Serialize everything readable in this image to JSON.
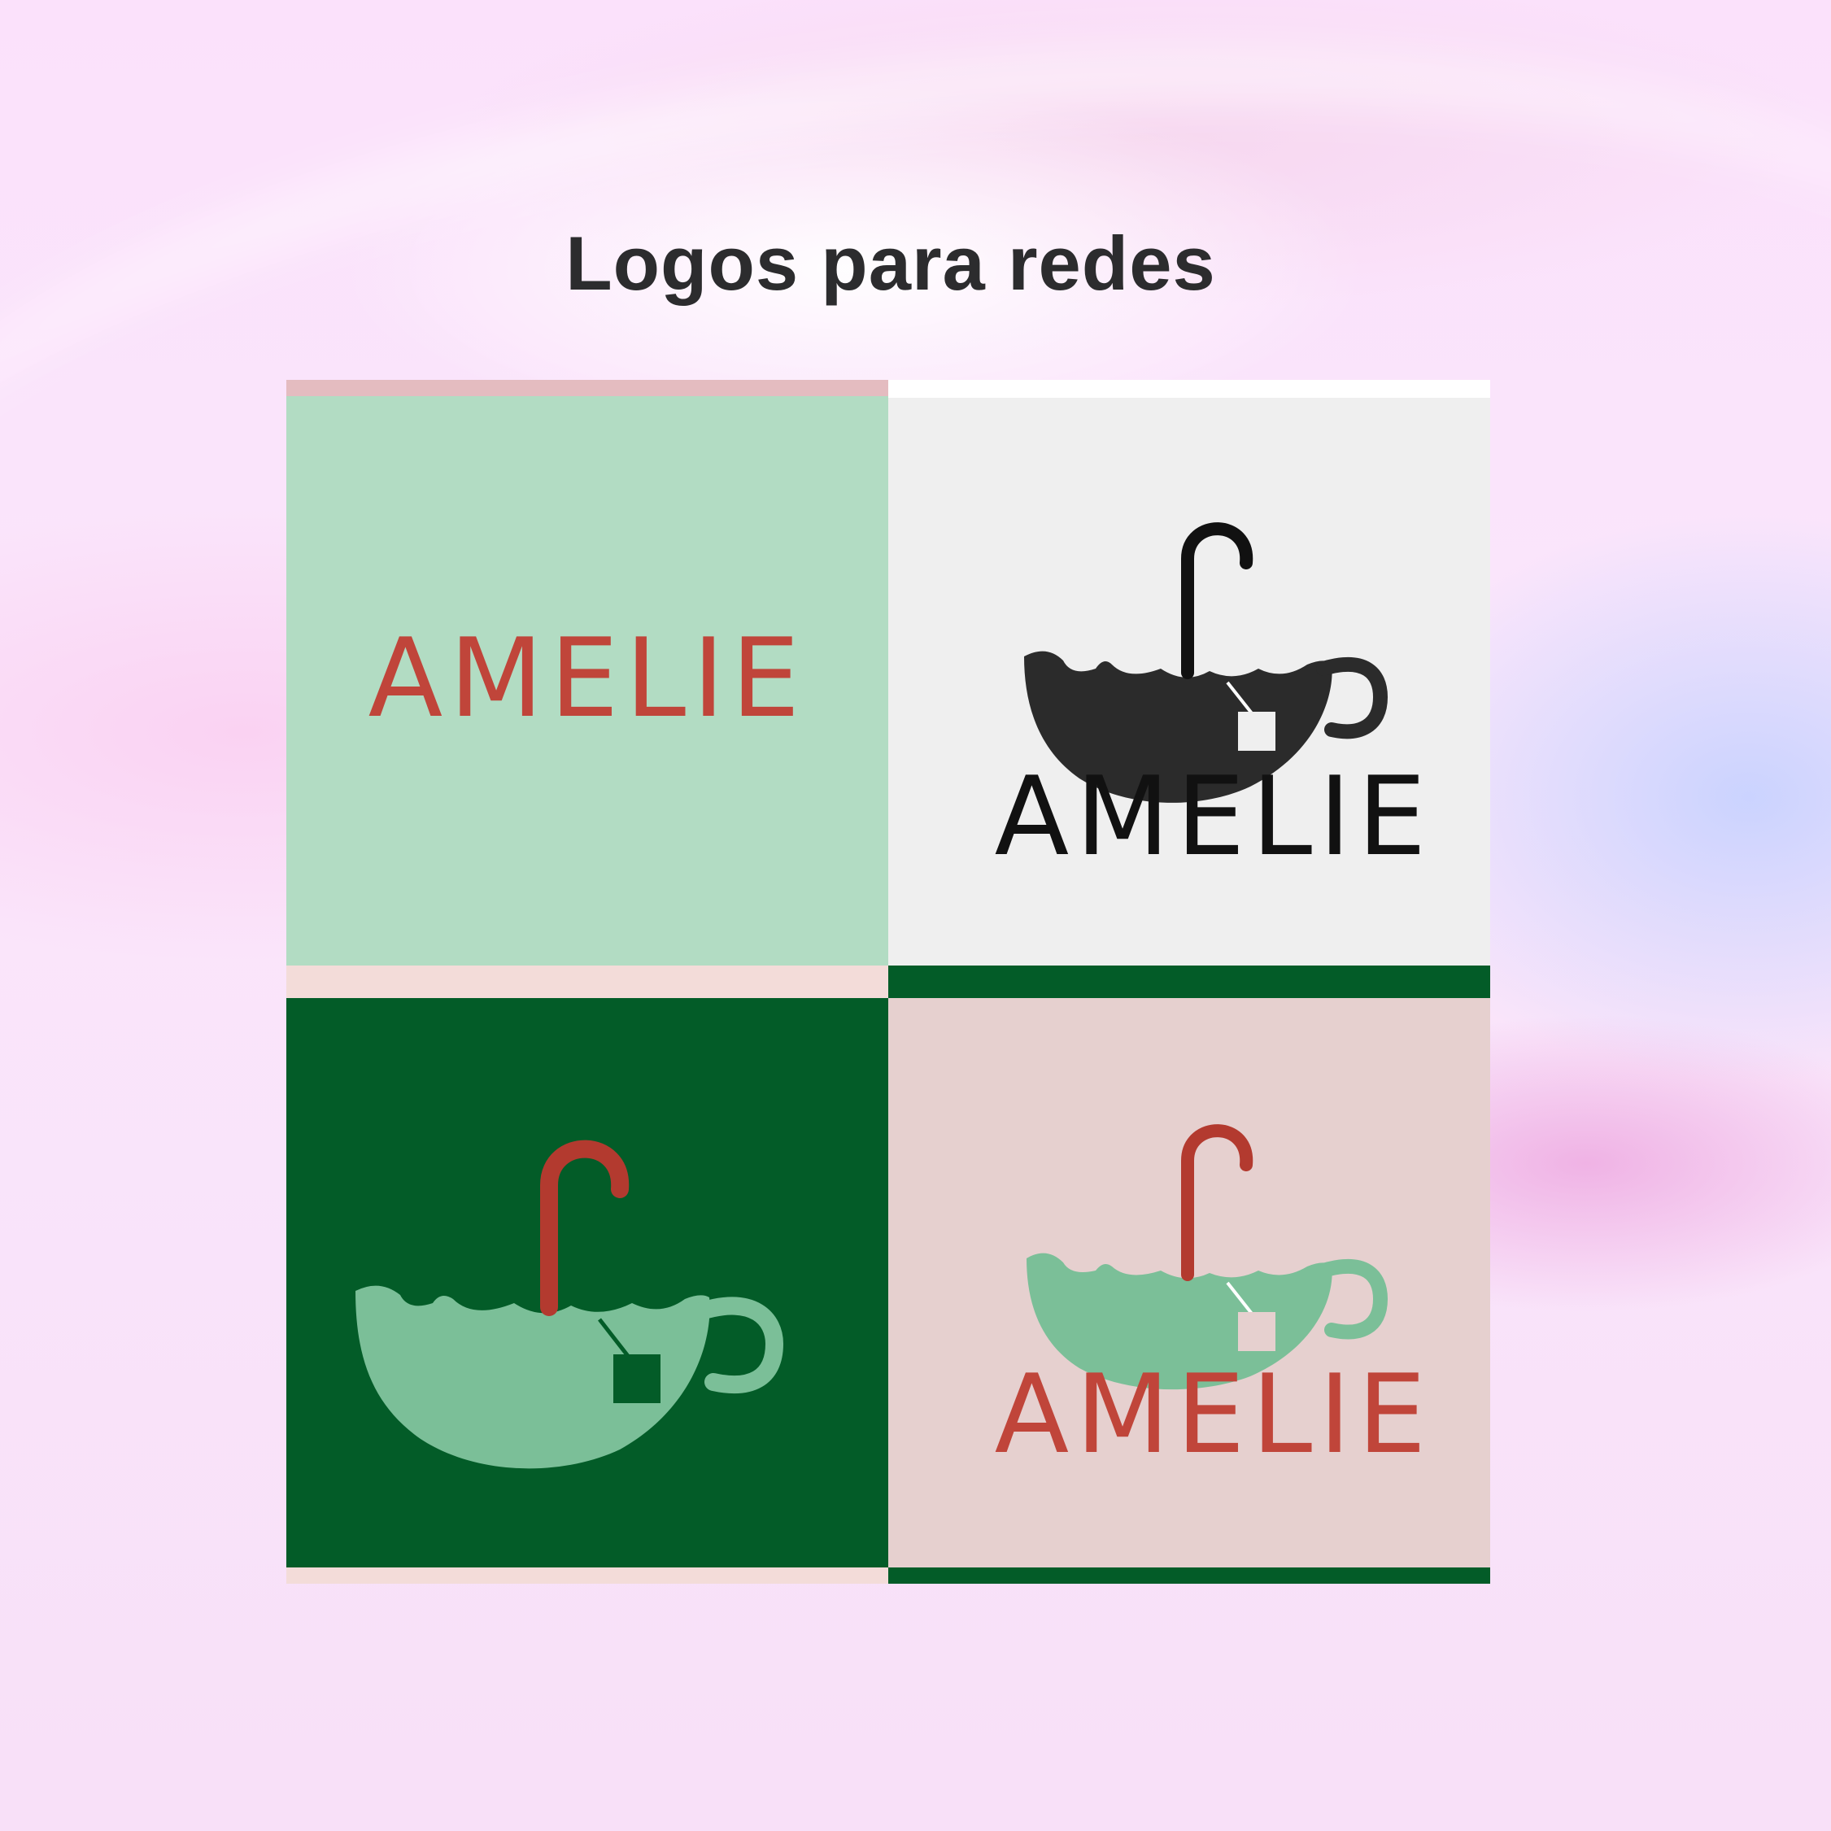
{
  "page": {
    "title": "Logos para redes"
  },
  "tiles": [
    {
      "wordmark": "AMELIE",
      "background": "#b2dcc3",
      "band_color": "#e4bcc0",
      "text_color": "#c0453a"
    },
    {
      "wordmark": "AMELIE",
      "background": "#efefef",
      "band_color": "#ffffff",
      "text_color": "#111111",
      "logo_color": "#2b2b2b",
      "handle_color": "#111111"
    },
    {
      "background": "#035c28",
      "band_color": "#f3dcd9",
      "logo_color": "#7bbf98",
      "handle_color": "#b33a2f"
    },
    {
      "wordmark": "AMELIE",
      "background": "#e6d0cf",
      "band_color": "#035c28",
      "text_color": "#c0453a",
      "logo_color": "#7bbf98",
      "handle_color": "#b33a2f"
    }
  ]
}
